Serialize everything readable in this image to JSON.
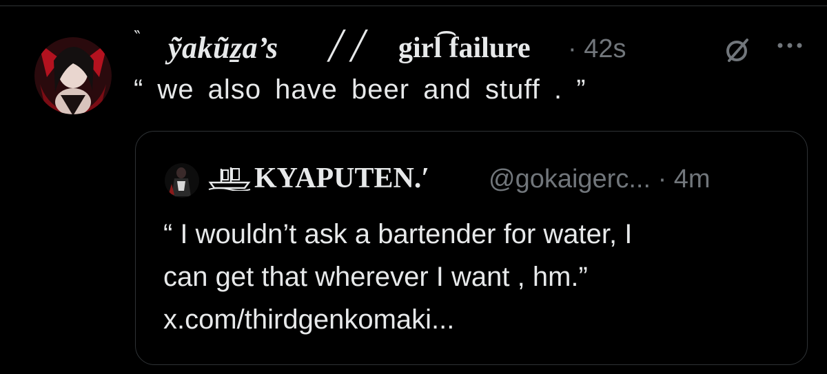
{
  "tweet": {
    "open_mark": "‶",
    "author_name_part1": "ỹakũẕa’s",
    "slashes": "╱╱",
    "author_name_part2": "girl͡ failure",
    "timestamp": "· 42s",
    "text": "“ we also have beer and stuff . ”",
    "icons": [
      "grok-icon",
      "more-icon"
    ]
  },
  "quote": {
    "author_name": "KYAPUTEN.′",
    "handle_time": "@gokaigerc... · 4m",
    "lines": [
      "“ I wouldn’t ask a bartender for water, I",
      "can get that wherever I want , hm.”",
      "x.com/thirdgenkomaki..."
    ],
    "icons": [
      "ship-icon"
    ]
  },
  "colors": {
    "background": "#000000",
    "text": "#e7e9ea",
    "muted": "#71767b",
    "border": "#2f3336",
    "avatar_accent": "#b3121f"
  }
}
